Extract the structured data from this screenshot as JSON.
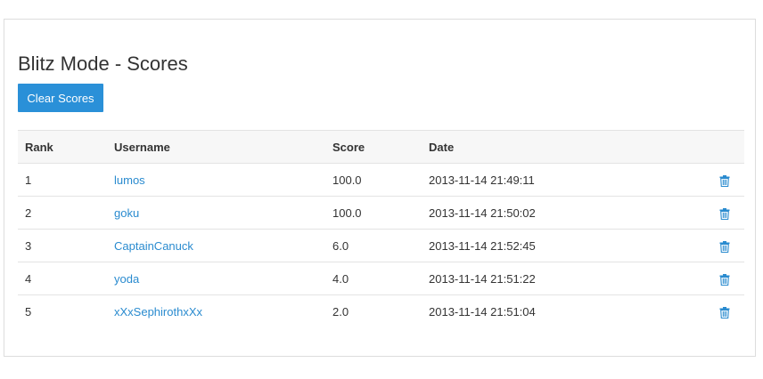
{
  "page": {
    "title": "Blitz Mode - Scores",
    "clear_button_label": "Clear Scores"
  },
  "table": {
    "headers": {
      "rank": "Rank",
      "username": "Username",
      "score": "Score",
      "date": "Date"
    },
    "rows": [
      {
        "rank": "1",
        "username": "lumos",
        "score": "100.0",
        "date": "2013-11-14 21:49:11",
        "action_icon": "trash-icon"
      },
      {
        "rank": "2",
        "username": "goku",
        "score": "100.0",
        "date": "2013-11-14 21:50:02",
        "action_icon": "trash-icon"
      },
      {
        "rank": "3",
        "username": "CaptainCanuck",
        "score": "6.0",
        "date": "2013-11-14 21:52:45",
        "action_icon": "trash-icon"
      },
      {
        "rank": "4",
        "username": "yoda",
        "score": "4.0",
        "date": "2013-11-14 21:51:22",
        "action_icon": "trash-icon"
      },
      {
        "rank": "5",
        "username": "xXxSephirothxXx",
        "score": "2.0",
        "date": "2013-11-14 21:51:04",
        "action_icon": "trash-icon"
      }
    ]
  },
  "colors": {
    "accent": "#2a90d8",
    "link": "#2a8bcf",
    "header_bg": "#f7f7f7",
    "border": "#dddddd"
  }
}
